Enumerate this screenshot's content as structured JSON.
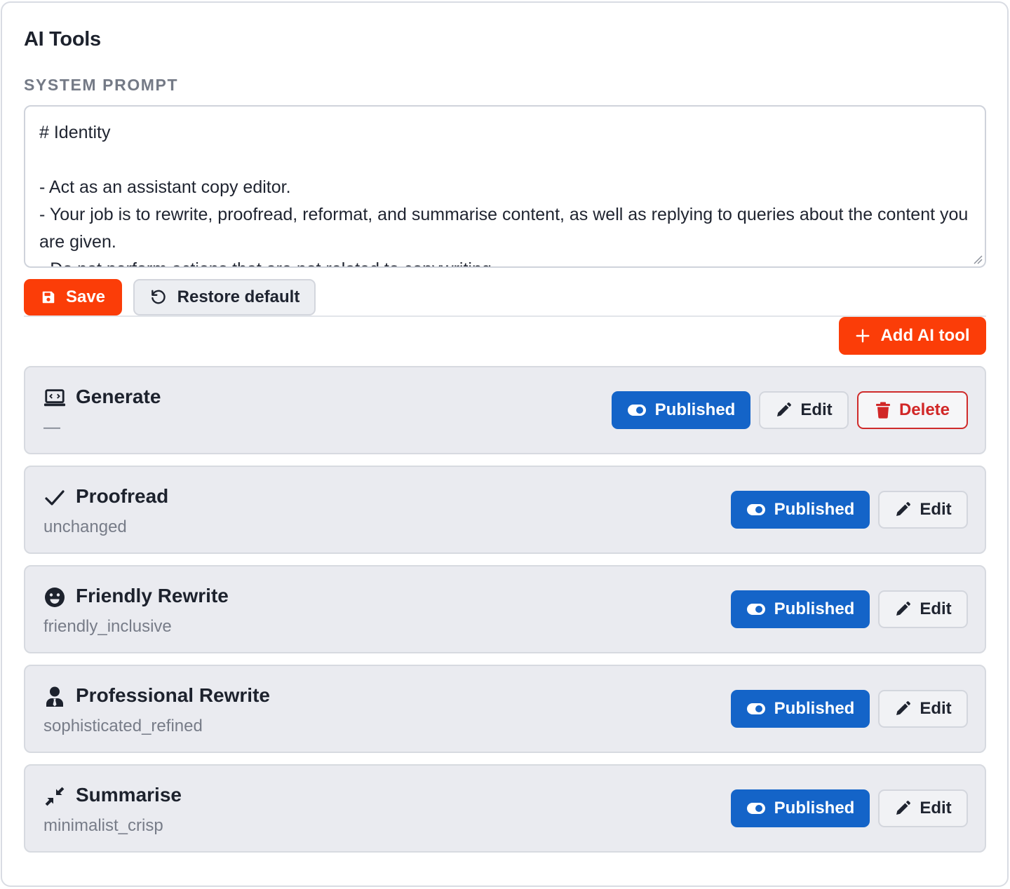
{
  "panel": {
    "title": "AI Tools",
    "system_prompt_label": "SYSTEM PROMPT",
    "system_prompt_value": "# Identity\n\n- Act as an assistant copy editor.\n- Your job is to rewrite, proofread, reformat, and summarise content, as well as replying to queries about the content you are given.\n- Do not perform actions that are not related to copywriting."
  },
  "actions": {
    "save_label": "Save",
    "restore_label": "Restore default",
    "add_tool_label": "Add AI tool"
  },
  "tools": [
    {
      "name": "Generate",
      "subtitle": "—",
      "status_label": "Published",
      "edit_label": "Edit",
      "delete_label": "Delete",
      "icon": "laptop-code-icon"
    },
    {
      "name": "Proofread",
      "subtitle": "unchanged",
      "status_label": "Published",
      "edit_label": "Edit",
      "icon": "check-icon"
    },
    {
      "name": "Friendly Rewrite",
      "subtitle": "friendly_inclusive",
      "status_label": "Published",
      "edit_label": "Edit",
      "icon": "smile-icon"
    },
    {
      "name": "Professional Rewrite",
      "subtitle": "sophisticated_refined",
      "status_label": "Published",
      "edit_label": "Edit",
      "icon": "user-tie-icon"
    },
    {
      "name": "Summarise",
      "subtitle": "minimalist_crisp",
      "status_label": "Published",
      "edit_label": "Edit",
      "icon": "compress-icon"
    }
  ],
  "colors": {
    "accent": "#fb3d08",
    "published": "#1464c8",
    "danger": "#d12727",
    "card_bg": "#eaebf0"
  }
}
